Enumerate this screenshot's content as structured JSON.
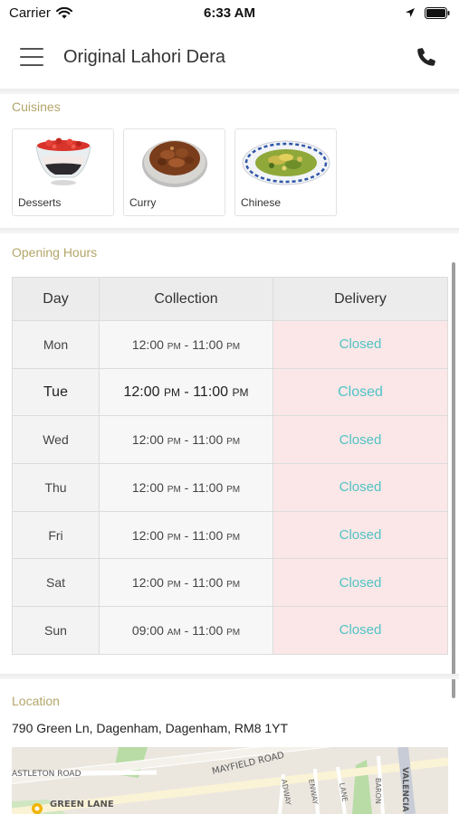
{
  "status_bar": {
    "carrier": "Carrier",
    "time": "6:33 AM"
  },
  "header": {
    "title": "Original Lahori Dera"
  },
  "cuisines": {
    "label": "Cuisines",
    "items": [
      {
        "label": "Desserts",
        "icon": "dessert-image"
      },
      {
        "label": "Curry",
        "icon": "curry-image"
      },
      {
        "label": "Chinese",
        "icon": "chinese-dish-image"
      }
    ]
  },
  "opening_hours": {
    "label": "Opening Hours",
    "columns": [
      "Day",
      "Collection",
      "Delivery"
    ],
    "rows": [
      {
        "day": "Mon",
        "open": "12:00",
        "open_ampm": "PM",
        "close": "11:00",
        "close_ampm": "PM",
        "delivery": "Closed"
      },
      {
        "day": "Tue",
        "open": "12:00",
        "open_ampm": "PM",
        "close": "11:00",
        "close_ampm": "PM",
        "delivery": "Closed"
      },
      {
        "day": "Wed",
        "open": "12:00",
        "open_ampm": "PM",
        "close": "11:00",
        "close_ampm": "PM",
        "delivery": "Closed"
      },
      {
        "day": "Thu",
        "open": "12:00",
        "open_ampm": "PM",
        "close": "11:00",
        "close_ampm": "PM",
        "delivery": "Closed"
      },
      {
        "day": "Fri",
        "open": "12:00",
        "open_ampm": "PM",
        "close": "11:00",
        "close_ampm": "PM",
        "delivery": "Closed"
      },
      {
        "day": "Sat",
        "open": "12:00",
        "open_ampm": "PM",
        "close": "11:00",
        "close_ampm": "PM",
        "delivery": "Closed"
      },
      {
        "day": "Sun",
        "open": "09:00",
        "open_ampm": "AM",
        "close": "11:00",
        "close_ampm": "PM",
        "delivery": "Closed"
      }
    ],
    "highlighted_day": "Tue"
  },
  "location": {
    "label": "Location",
    "address": "790 Green Ln, Dagenham, Dagenham, RM8 1YT",
    "map_labels": [
      "MAYFIELD ROAD",
      "ASTLETON ROAD",
      "GREEN LANE",
      "VALENCIA",
      "BARON",
      "ENWAY",
      "ADWAY",
      "LANE"
    ]
  },
  "colors": {
    "section_label": "#b3a66a",
    "closed_text": "#4fc3c6",
    "delivery_bg": "#fbe7e7"
  }
}
